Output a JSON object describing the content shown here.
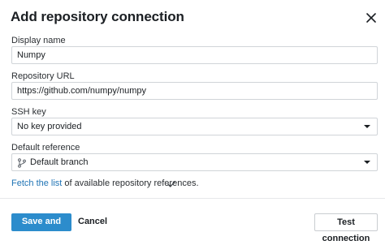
{
  "dialog": {
    "title": "Add repository connection"
  },
  "display_name": {
    "label": "Display name",
    "value": "Numpy"
  },
  "repository_url": {
    "label": "Repository URL",
    "value": "https://github.com/numpy/numpy"
  },
  "ssh_key": {
    "label": "SSH key",
    "selected": "No key provided"
  },
  "default_reference": {
    "label": "Default reference",
    "selected": "Default branch",
    "icon": "git-branch-icon"
  },
  "fetch": {
    "link_text": "Fetch the list",
    "rest_text": " of available repository references.",
    "status_icon": "check-icon"
  },
  "footer": {
    "save_label": "Save and close",
    "cancel_label": "Cancel",
    "test_label": "Test connection"
  },
  "colors": {
    "primary": "#2c8ccc",
    "link": "#1f74b5"
  }
}
